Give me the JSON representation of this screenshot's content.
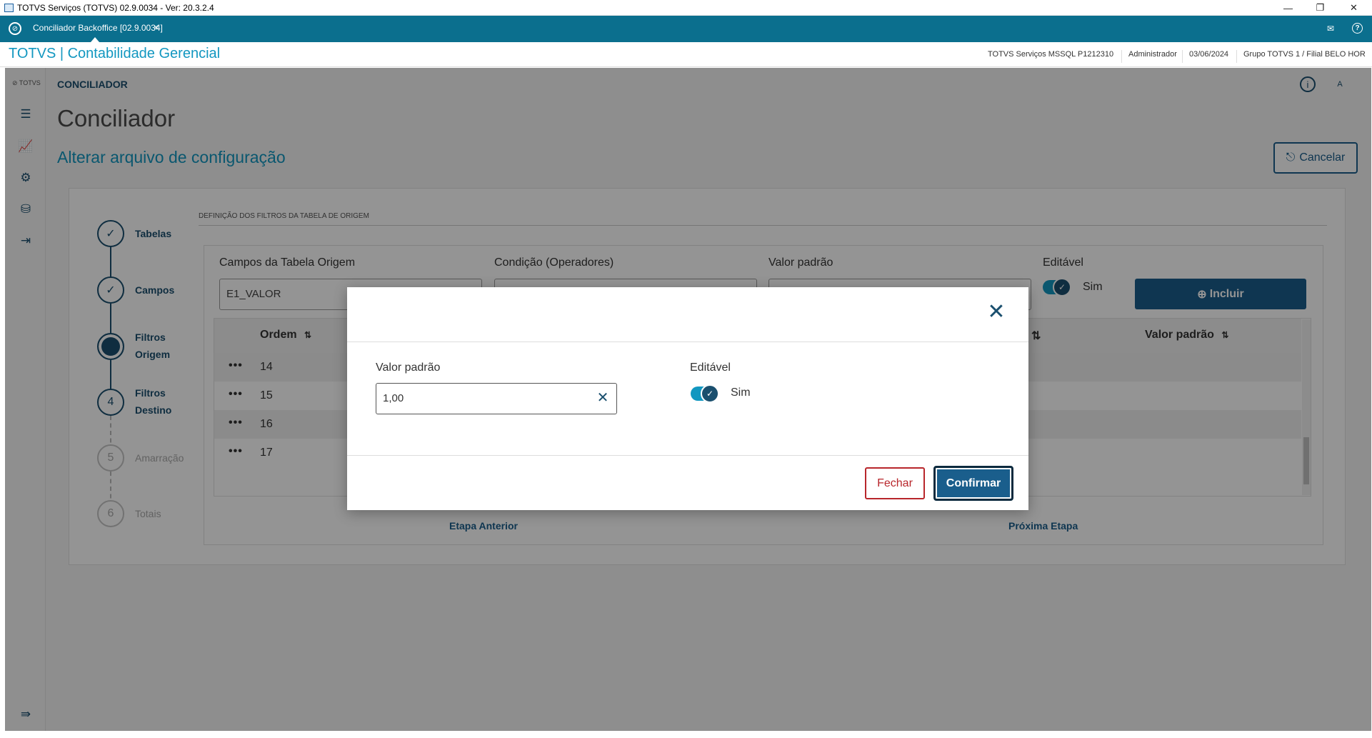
{
  "window": {
    "title": "TOTVS Serviços (TOTVS) 02.9.0034 - Ver: 20.3.2.4",
    "minimize": "—",
    "restore": "❐",
    "close": "✕"
  },
  "tabbar": {
    "tab_label": "Conciliador Backoffice [02.9.0034]",
    "tab_close": "×",
    "mail_icon": "✉",
    "help_icon": "?"
  },
  "product": {
    "brand": "TOTVS | Contabilidade Gerencial",
    "server": "TOTVS Serviços MSSQL P1212310",
    "user": "Administrador",
    "date": "03/06/2024",
    "company": "Grupo TOTVS 1 / Filial BELO HOR"
  },
  "sidebar": {
    "logo": "⊘ TOTVS",
    "items": [
      {
        "icon": "list-icon",
        "glyph": "☰"
      },
      {
        "icon": "chart-icon",
        "glyph": "📈"
      },
      {
        "icon": "gear-icon",
        "glyph": "⚙"
      },
      {
        "icon": "database-icon",
        "glyph": "⛁"
      },
      {
        "icon": "logout-icon",
        "glyph": "⇥"
      }
    ],
    "collapse_glyph": "⇛"
  },
  "page": {
    "breadcrumb": "CONCILIADOR",
    "title": "Conciliador",
    "subtitle": "Alterar arquivo de configuração",
    "cancel_label": "Cancelar",
    "cancel_icon": "⎋",
    "info_icon": "i",
    "user_icon": "A"
  },
  "stepper": {
    "check": "✓",
    "steps": [
      {
        "num": "",
        "line1": "Tabelas",
        "line2": ""
      },
      {
        "num": "",
        "line1": "Campos",
        "line2": ""
      },
      {
        "num": "",
        "line1": "Filtros",
        "line2": "Origem"
      },
      {
        "num": "4",
        "line1": "Filtros",
        "line2": "Destino"
      },
      {
        "num": "5",
        "line1": "Amarração",
        "line2": ""
      },
      {
        "num": "6",
        "line1": "Totais",
        "line2": ""
      }
    ]
  },
  "section": {
    "title": "DEFINIÇÃO DOS FILTROS DA TABELA DE ORIGEM",
    "field_origem_label": "Campos da Tabela Origem",
    "field_origem_value": "E1_VALOR",
    "field_condicao_label": "Condição (Operadores)",
    "field_valor_label": "Valor padrão",
    "field_editavel_label": "Editável",
    "editavel_value": "Sim",
    "incluir_label": "Incluir",
    "incluir_icon": "⊕"
  },
  "table": {
    "col_ordem": "Ordem",
    "col_valor": "Valor padrão",
    "sort_icon": "⇅",
    "more_icon": "•••",
    "rows": [
      "14",
      "15",
      "16",
      "17"
    ]
  },
  "footer_nav": {
    "prev": "Etapa Anterior",
    "next": "Próxima Etapa"
  },
  "modal": {
    "close_icon": "✕",
    "valor_label": "Valor padrão",
    "valor_value": "1,00",
    "clear_icon": "✕",
    "editavel_label": "Editável",
    "editavel_value": "Sim",
    "fechar_label": "Fechar",
    "confirmar_label": "Confirmar"
  },
  "colors": {
    "teal": "#0b6f8e",
    "brand_blue": "#1297c0",
    "primary": "#1a5e8c",
    "danger": "#b8262b"
  }
}
